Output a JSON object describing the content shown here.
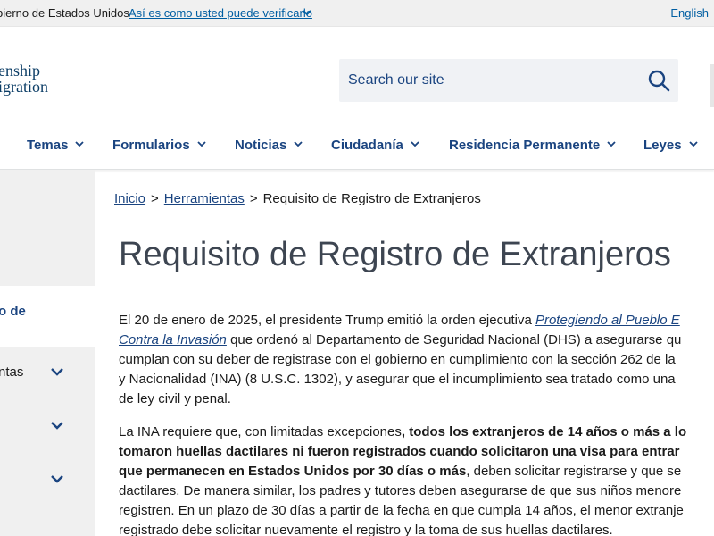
{
  "gov_banner": {
    "text": "bierno de Estados Unidos",
    "verify_link": "Así es como usted puede verificarlo",
    "language": "English"
  },
  "logo": {
    "line1": "enship",
    "line2": "igration"
  },
  "search": {
    "placeholder": "Search our site"
  },
  "nav": {
    "items": [
      {
        "label": "Temas"
      },
      {
        "label": "Formularios"
      },
      {
        "label": "Noticias"
      },
      {
        "label": "Ciudadanía"
      },
      {
        "label": "Residencia Permanente"
      },
      {
        "label": "Leyes"
      }
    ]
  },
  "sidebar": {
    "active_label": "o de",
    "items": [
      {
        "label": "ntas"
      },
      {
        "label": ""
      },
      {
        "label": ""
      }
    ]
  },
  "breadcrumb": {
    "home": "Inicio",
    "sep1": ">",
    "tools": "Herramientas",
    "sep2": ">",
    "current": "Requisito de Registro de Extranjeros"
  },
  "page_title": "Requisito de Registro de Extranjeros",
  "para1": {
    "l1_text": "El 20 de enero de 2025, el presidente Trump emitió la orden ejecutiva ",
    "l1_link": "Protegiendo al Pueblo E",
    "l2_link": "Contra la Invasión",
    "l2_text": " que ordenó al Departamento de Seguridad Nacional (DHS) a asegurarse qu",
    "l3": "cumplan con su deber de registrase con el gobierno en cumplimiento con la sección 262 de la",
    "l4": "y Nacionalidad (INA) (8 U.S.C. 1302), y asegurar que el incumplimiento sea tratado como una",
    "l5": "de ley civil y penal."
  },
  "para2": {
    "l1_text": "La INA requiere que, con limitadas excepciones",
    "l1_bold": ", todos los extranjeros de 14 años o más a lo",
    "l2_bold": "tomaron huellas dactilares ni fueron registrados cuando solicitaron una visa para entrar",
    "l3_bold": "que permanecen en Estados Unidos por 30 días o más",
    "l3_text": ", deben solicitar registrarse y que se",
    "l4": "dactilares. De manera similar, los padres y tutores deben asegurarse de que sus niños menore",
    "l5": "registren. En un plazo de 30 días a partir de la fecha en que cumpla 14 años, el menor extranje",
    "l6": "registrado debe solicitar nuevamente el registro y la toma de sus huellas dactilares."
  },
  "colors": {
    "link": "#005ea2",
    "nav": "#1a4480",
    "title": "#3d4551",
    "gray_bg": "#f0f0f0"
  }
}
